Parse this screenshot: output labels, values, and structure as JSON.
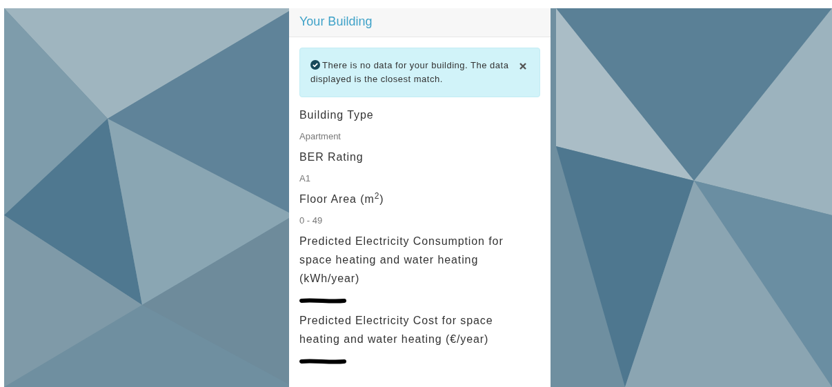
{
  "panel": {
    "title": "Your Building"
  },
  "alert": {
    "text": "There is no data for your building. The data displayed is the closest match.",
    "dismissible": true
  },
  "fields": [
    {
      "label": "Building Type",
      "value": "Apartment"
    },
    {
      "label": "BER Rating",
      "value": "A1"
    },
    {
      "label": "Floor Area (m$^{2}$)",
      "value": "0 - 49"
    },
    {
      "label": "Predicted Electricity Consumption for space heating and water heating (kWh/year)",
      "redacted": true
    },
    {
      "label": "Predicted Electricity Cost for space heating and water heating (€/year)",
      "redacted": true
    }
  ]
}
